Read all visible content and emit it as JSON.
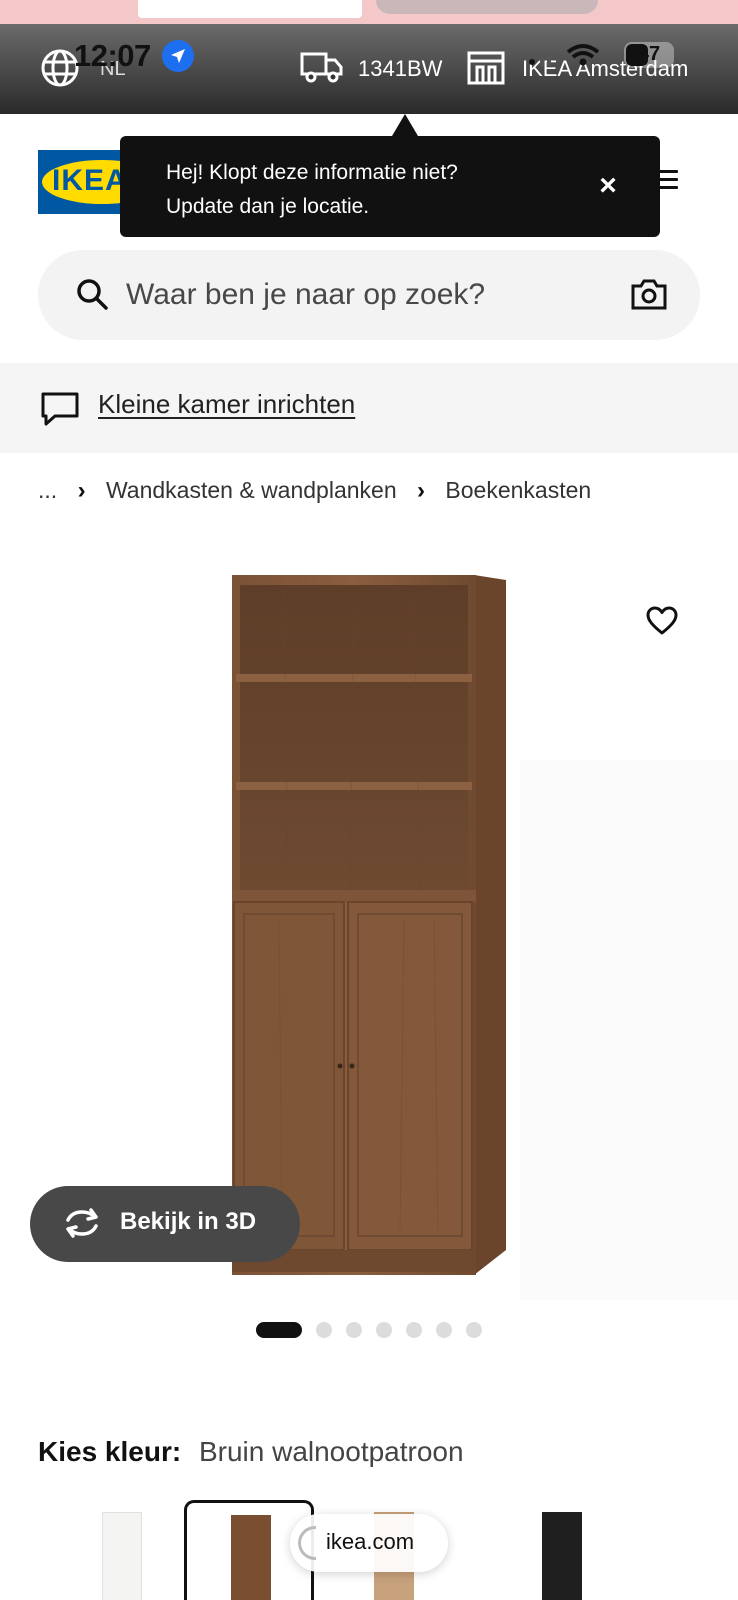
{
  "status_bar": {
    "time": "12:07",
    "battery": "47"
  },
  "location_bar": {
    "language": "NL",
    "postcode": "1341BW",
    "store": "IKEA Amsterdam"
  },
  "header": {
    "logo_text": "IKEA"
  },
  "tooltip": {
    "line1": "Hej! Klopt deze informatie niet?",
    "line2": "Update dan je locatie.",
    "close_label": "×"
  },
  "search": {
    "placeholder": "Waar ben je naar op zoek?"
  },
  "banner": {
    "link_text": "Kleine kamer inrichten"
  },
  "breadcrumb": {
    "items": [
      "...",
      "Wandkasten & wandplanken",
      "Boekenkasten"
    ]
  },
  "product_image": {
    "view_3d_label": "Bekijk in 3D",
    "gallery_count": 7,
    "active_index": 0
  },
  "color_picker": {
    "label": "Kies kleur:",
    "selected": "Bruin walnootpatroon",
    "swatches": [
      {
        "color": "#f4f4f2",
        "selected": false
      },
      {
        "color": "#7a4f31",
        "selected": true
      },
      {
        "color": "#c7a27c",
        "selected": false
      },
      {
        "color": "#1f1f1f",
        "selected": false
      }
    ]
  },
  "browser": {
    "url": "ikea.com"
  },
  "colors": {
    "ikea_blue": "#0058a3",
    "ikea_yellow": "#ffdb00",
    "walnut": "#7a4f31",
    "location_blue": "#1e6ff0"
  }
}
